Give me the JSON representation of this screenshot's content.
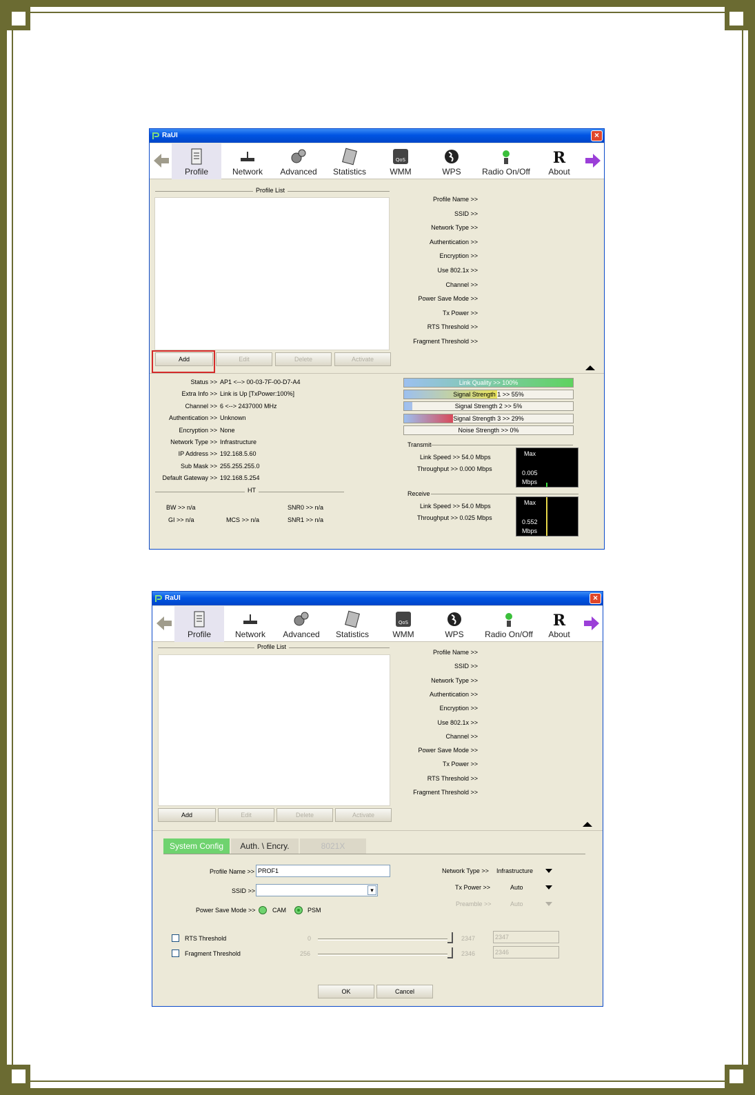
{
  "window1": {
    "title": "RaUI",
    "toolbar": [
      "Profile",
      "Network",
      "Advanced",
      "Statistics",
      "WMM",
      "WPS",
      "Radio On/Off",
      "About"
    ],
    "profile_list_title": "Profile List",
    "buttons": {
      "add": "Add",
      "edit": "Edit",
      "delete": "Delete",
      "activate": "Activate"
    },
    "profile_labels": [
      "Profile Name >>",
      "SSID >>",
      "Network Type >>",
      "Authentication >>",
      "Encryption >>",
      "Use 802.1x >>",
      "Channel >>",
      "Power Save Mode >>",
      "Tx Power >>",
      "RTS Threshold >>",
      "Fragment Threshold >>"
    ],
    "status": [
      {
        "k": "Status >>",
        "v": "AP1 <--> 00-03-7F-00-D7-A4"
      },
      {
        "k": "Extra Info >>",
        "v": "Link is Up [TxPower:100%]"
      },
      {
        "k": "Channel >>",
        "v": "6 <--> 2437000 MHz"
      },
      {
        "k": "Authentication >>",
        "v": "Unknown"
      },
      {
        "k": "Encryption >>",
        "v": "None"
      },
      {
        "k": "Network Type >>",
        "v": "Infrastructure"
      },
      {
        "k": "IP Address >>",
        "v": "192.168.5.60"
      },
      {
        "k": "Sub Mask >>",
        "v": "255.255.255.0"
      },
      {
        "k": "Default Gateway >>",
        "v": "192.168.5.254"
      }
    ],
    "ht_title": "HT",
    "ht": {
      "bw": "BW >> n/a",
      "gi": "GI >> n/a",
      "mcs": "MCS >> n/a",
      "snr0": "SNR0 >> n/a",
      "snr1": "SNR1 >> n/a"
    },
    "bars": [
      {
        "label": "Link Quality >> 100%",
        "level": 100,
        "color": "#5fd35f"
      },
      {
        "label": "Signal Strength 1 >> 55%",
        "level": 55,
        "color": "#e8e25a"
      },
      {
        "label": "Signal Strength 2 >> 5%",
        "level": 5,
        "color": "#a8c0e8"
      },
      {
        "label": "Signal Strength 3 >> 29%",
        "level": 29,
        "color": "#d84a5a"
      },
      {
        "label": "Noise Strength >> 0%",
        "level": 0,
        "color": "#a8c0e8"
      }
    ],
    "transmit": {
      "title": "Transmit",
      "link_speed": "Link Speed >> 54.0 Mbps",
      "throughput": "Throughput >> 0.000 Mbps",
      "max": "Max",
      "value": "0.005",
      "unit": "Mbps"
    },
    "receive": {
      "title": "Receive",
      "link_speed": "Link Speed >> 54.0 Mbps",
      "throughput": "Throughput >> 0.025 Mbps",
      "max": "Max",
      "value": "0.552",
      "unit": "Mbps"
    }
  },
  "window2": {
    "title": "RaUI",
    "tabs": [
      "System Config",
      "Auth. \\ Encry.",
      "8021X"
    ],
    "profile_name_label": "Profile Name >>",
    "profile_name_value": "PROF1",
    "ssid_label": "SSID >>",
    "psm_label": "Power Save Mode >>",
    "cam": "CAM",
    "psm": "PSM",
    "network_type_label": "Network Type >>",
    "network_type_value": "Infrastructure",
    "tx_power_label": "Tx Power >>",
    "tx_power_value": "Auto",
    "preamble_label": "Preamble >>",
    "preamble_value": "Auto",
    "rts_label": "RTS Threshold",
    "rts_min": "0",
    "rts_max": "2347",
    "rts_value": "2347",
    "frag_label": "Fragment Threshold",
    "frag_min": "256",
    "frag_max": "2346",
    "frag_value": "2346",
    "ok": "OK",
    "cancel": "Cancel"
  }
}
